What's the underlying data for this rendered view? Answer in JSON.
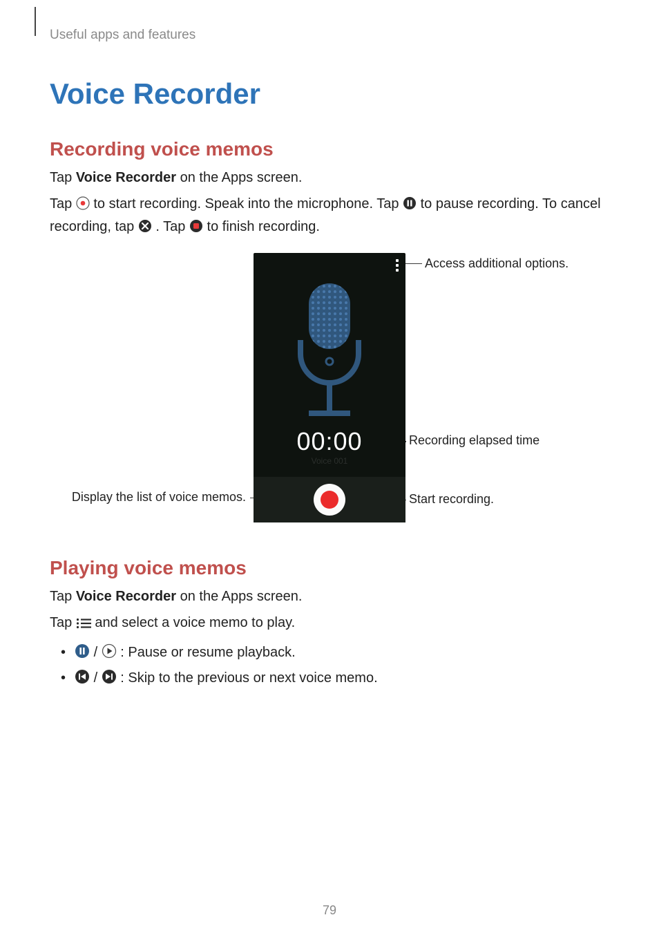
{
  "header": {
    "breadcrumb": "Useful apps and features"
  },
  "title": "Voice Recorder",
  "sections": {
    "recording": {
      "heading": "Recording voice memos",
      "p1_pre": "Tap ",
      "p1_bold": "Voice Recorder",
      "p1_post": " on the Apps screen.",
      "p2_a": "Tap ",
      "p2_b": " to start recording. Speak into the microphone. Tap ",
      "p2_c": " to pause recording. To cancel recording, tap ",
      "p2_d": ". Tap ",
      "p2_e": " to finish recording."
    },
    "playing": {
      "heading": "Playing voice memos",
      "p1_pre": "Tap ",
      "p1_bold": "Voice Recorder",
      "p1_post": " on the Apps screen.",
      "p2_a": "Tap ",
      "p2_b": " and select a voice memo to play.",
      "li1": " : Pause or resume playback.",
      "li2": " : Skip to the previous or next voice memo."
    }
  },
  "figure": {
    "timer": "00:00",
    "callouts": {
      "options": "Access additional options.",
      "elapsed": "Recording elapsed time",
      "list": "Display the list of voice memos.",
      "record": "Start recording."
    }
  },
  "page_number": "79"
}
